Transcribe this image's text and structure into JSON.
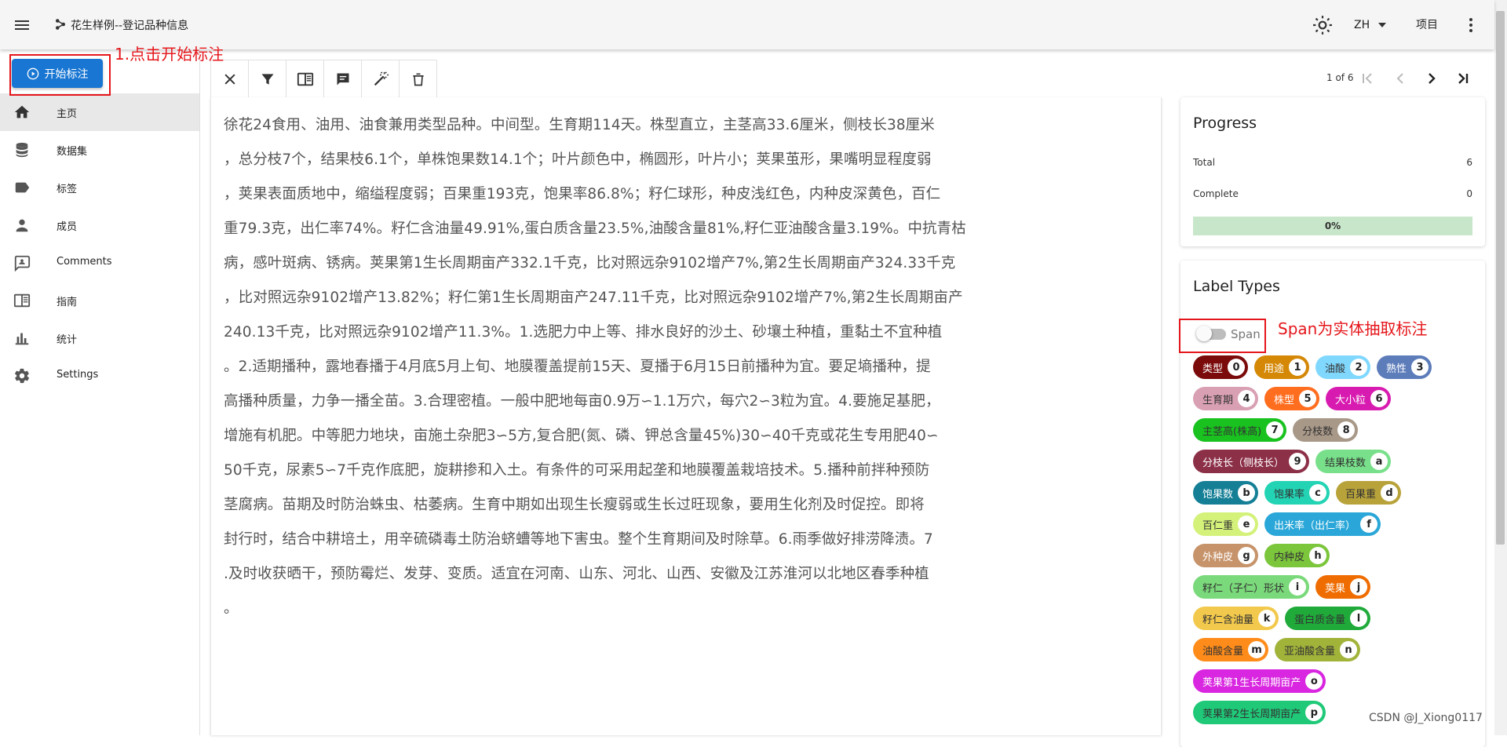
{
  "appbar": {
    "title": "花生样例--登记品种信息",
    "language": "ZH",
    "project_link": "项目"
  },
  "nav": {
    "start_button": "开始标注",
    "items": [
      {
        "label": "主页",
        "icon": "home-icon"
      },
      {
        "label": "数据集",
        "icon": "database-icon"
      },
      {
        "label": "标签",
        "icon": "label-icon"
      },
      {
        "label": "成员",
        "icon": "person-icon"
      },
      {
        "label": "Comments",
        "icon": "comment-icon"
      },
      {
        "label": "指南",
        "icon": "book-icon"
      },
      {
        "label": "统计",
        "icon": "chart-icon"
      },
      {
        "label": "Settings",
        "icon": "gear-icon"
      }
    ]
  },
  "annotations": {
    "note1": "1.点击开始标注",
    "note2": "Span为实体抽取标注"
  },
  "toolbar": {
    "buttons": [
      "close-icon",
      "filter-icon",
      "book-open-icon",
      "comment-icon",
      "auto-label-icon",
      "delete-icon"
    ],
    "pager_text": "1 of 6"
  },
  "document": {
    "lines": [
      "徐花24食用、油用、油食兼用类型品种。中间型。生育期114天。株型直立，主茎高33.6厘米，侧枝长38厘米",
      "，总分枝7个，结果枝6.1个，单株饱果数14.1个；叶片颜色中，椭圆形，叶片小；荚果茧形，果嘴明显程度弱",
      "，荚果表面质地中，缩缢程度弱；百果重193克，饱果率86.8%；籽仁球形，种皮浅红色，内种皮深黄色，百仁",
      "重79.3克，出仁率74%。籽仁含油量49.91%,蛋白质含量23.5%,油酸含量81%,籽仁亚油酸含量3.19%。中抗青枯",
      "病，感叶斑病、锈病。荚果第1生长周期亩产332.1千克，比对照远杂9102增产7%,第2生长周期亩产324.33千克",
      "，比对照远杂9102增产13.82%；籽仁第1生长周期亩产247.11千克，比对照远杂9102增产7%,第2生长周期亩产",
      "240.13千克，比对照远杂9102增产11.3%。1.选肥力中上等、排水良好的沙土、砂壤土种植，重黏土不宜种植",
      "。2.适期播种，露地春播于4月底5月上旬、地膜覆盖提前15天、夏播于6月15日前播种为宜。要足墒播种，提",
      "高播种质量，力争一播全苗。3.合理密植。一般中肥地每亩0.9万∽1.1万穴，每穴2∽3粒为宜。4.要施足基肥，",
      "增施有机肥。中等肥力地块，亩施土杂肥3∽5方,复合肥(氮、磷、钾总含量45%)30∽40千克或花生专用肥40∽",
      "50千克，尿素5∽7千克作底肥，旋耕掺和入土。有条件的可采用起垄和地膜覆盖栽培技术。5.播种前拌种预防",
      "茎腐病。苗期及时防治蛛虫、枯萎病。生育中期如出现生长瘦弱或生长过旺现象，要用生化剂及时促控。即将",
      "封行时，结合中耕培土，用辛硫磷毒土防治蛴螬等地下害虫。整个生育期间及时除草。6.雨季做好排涝降渍。7",
      ".及时收获晒干，预防霉烂、发芽、变质。适宜在河南、山东、河北、山西、安徽及江苏淮河以北地区春季种植",
      "。"
    ]
  },
  "progress": {
    "title": "Progress",
    "total_label": "Total",
    "total_value": "6",
    "complete_label": "Complete",
    "complete_value": "0",
    "percent": "0%",
    "fraction": 0
  },
  "label_types": {
    "title": "Label Types",
    "toggle_label": "Span",
    "labels": [
      {
        "text": "类型",
        "key": "0",
        "color": "#7b0b0b",
        "fg": "#ffffff"
      },
      {
        "text": "用途",
        "key": "1",
        "color": "#d48806",
        "fg": "#ffffff"
      },
      {
        "text": "油酸",
        "key": "2",
        "color": "#80d8ff",
        "fg": "#333333"
      },
      {
        "text": "熟性",
        "key": "3",
        "color": "#5c7cba",
        "fg": "#ffffff"
      },
      {
        "text": "生育期",
        "key": "4",
        "color": "#d9a0b3",
        "fg": "#333333"
      },
      {
        "text": "株型",
        "key": "5",
        "color": "#ff6d1f",
        "fg": "#ffffff"
      },
      {
        "text": "大小粒",
        "key": "6",
        "color": "#d81bb0",
        "fg": "#ffffff"
      },
      {
        "text": "主茎高(株高)",
        "key": "7",
        "color": "#19c21f",
        "fg": "#333333"
      },
      {
        "text": "分枝数",
        "key": "8",
        "color": "#a89888",
        "fg": "#333333"
      },
      {
        "text": "分枝长（侧枝长）",
        "key": "9",
        "color": "#8c3048",
        "fg": "#ffffff"
      },
      {
        "text": "结果枝数",
        "key": "a",
        "color": "#78e08a",
        "fg": "#333333"
      },
      {
        "text": "饱果数",
        "key": "b",
        "color": "#157f96",
        "fg": "#ffffff"
      },
      {
        "text": "饱果率",
        "key": "c",
        "color": "#22d3b4",
        "fg": "#333333"
      },
      {
        "text": "百果重",
        "key": "d",
        "color": "#b8a33a",
        "fg": "#333333"
      },
      {
        "text": "百仁重",
        "key": "e",
        "color": "#d4f27a",
        "fg": "#333333"
      },
      {
        "text": "出米率（出仁率）",
        "key": "f",
        "color": "#2aa7d8",
        "fg": "#ffffff"
      },
      {
        "text": "外种皮",
        "key": "g",
        "color": "#c6936a",
        "fg": "#ffffff"
      },
      {
        "text": "内种皮",
        "key": "h",
        "color": "#7cc63c",
        "fg": "#333333"
      },
      {
        "text": "籽仁（子仁）形状",
        "key": "i",
        "color": "#7ad97a",
        "fg": "#333333"
      },
      {
        "text": "荚果",
        "key": "j",
        "color": "#ef6c00",
        "fg": "#ffffff"
      },
      {
        "text": "籽仁含油量",
        "key": "k",
        "color": "#f2c94c",
        "fg": "#333333"
      },
      {
        "text": "蛋白质含量",
        "key": "l",
        "color": "#1faa3a",
        "fg": "#333333"
      },
      {
        "text": "油酸含量",
        "key": "m",
        "color": "#ff8c1a",
        "fg": "#333333"
      },
      {
        "text": "亚油酸含量",
        "key": "n",
        "color": "#a2b33a",
        "fg": "#333333"
      },
      {
        "text": "荚果第1生长周期亩产",
        "key": "o",
        "color": "#d926e0",
        "fg": "#ffffff"
      },
      {
        "text": "荚果第2生长周期亩产",
        "key": "p",
        "color": "#1fc978",
        "fg": "#333333"
      }
    ]
  },
  "watermark": "CSDN @J_Xiong0117"
}
